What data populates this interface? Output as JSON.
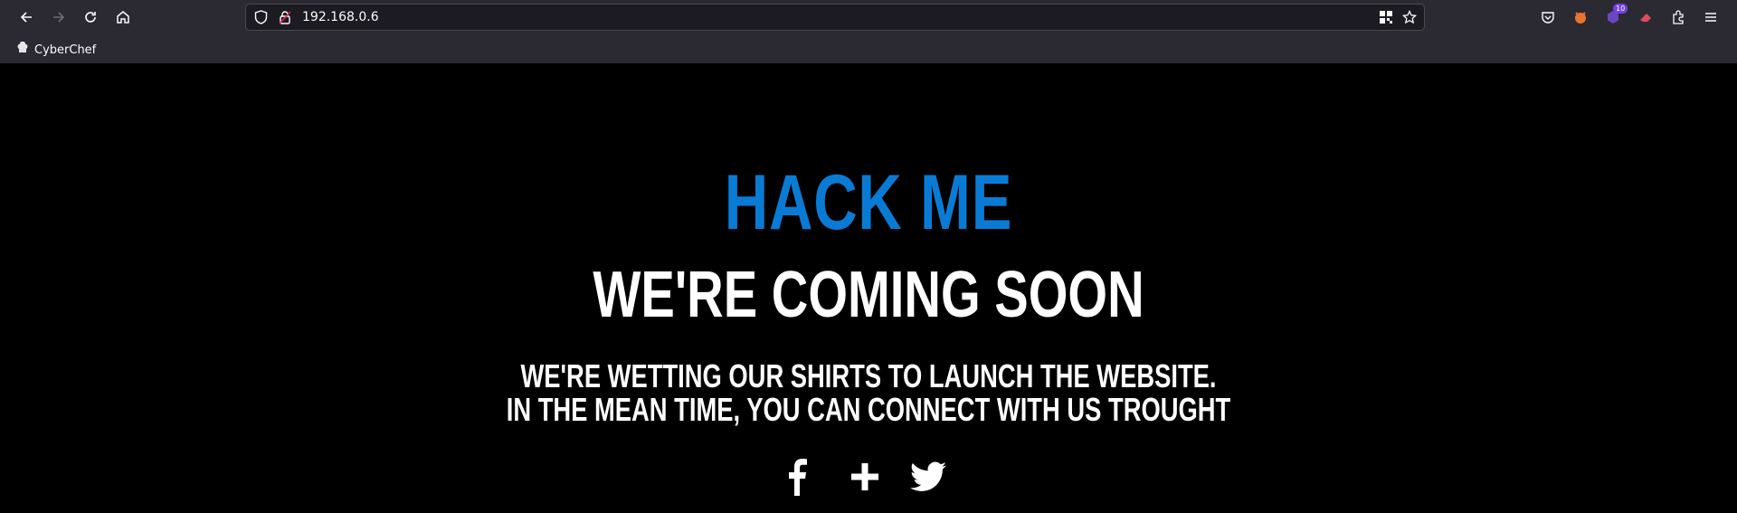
{
  "browser": {
    "url": "192.168.0.6",
    "bookmarks": [
      {
        "label": "CyberChef"
      }
    ],
    "extension_badge_count": "10"
  },
  "page": {
    "title": "HACK ME",
    "subtitle": "WE'RE COMING SOON",
    "message_line1": "WE'RE WETTING OUR SHIRTS TO LAUNCH THE WEBSITE.",
    "message_line2": "IN THE MEAN TIME, YOU CAN CONNECT WITH US TROUGHT",
    "social": [
      {
        "icon": "facebook-icon"
      },
      {
        "icon": "plus-icon"
      },
      {
        "icon": "twitter-icon"
      }
    ]
  },
  "colors": {
    "title": "#0a7bd5",
    "background": "#000000",
    "chrome": "#2b2a33"
  }
}
